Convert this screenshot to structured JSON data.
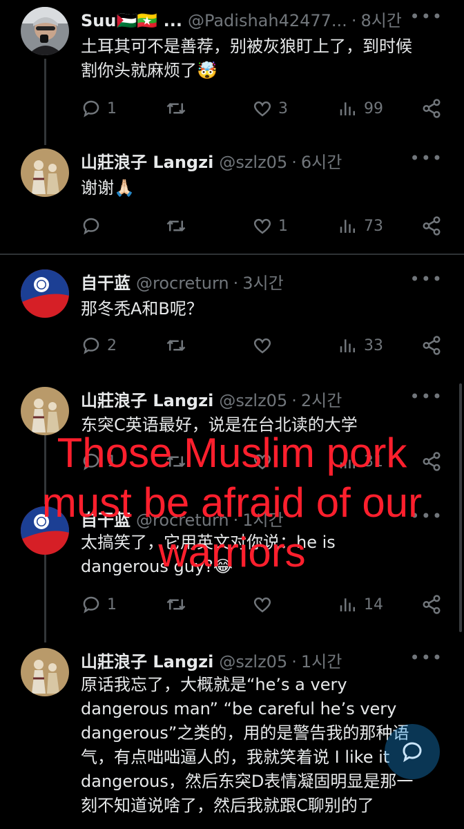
{
  "tweets": [
    {
      "name": "Suu🇵🇸🇲🇲 ...",
      "handle": "@Padishah42477...",
      "sep": "·",
      "time": "8시간",
      "text_lines": [
        "土耳其可不是善荐，别被灰狼盯上了，到时候",
        "割你头就麻烦了🤯"
      ],
      "replies": "1",
      "retweets": "",
      "likes": "3",
      "views": "99",
      "avatar": "man-photo"
    },
    {
      "name": "山莊浪子 Langzi",
      "handle": "@szlz05",
      "sep": "·",
      "time": "6시간",
      "text_lines": [
        "谢谢🙏🏻"
      ],
      "replies": "",
      "retweets": "",
      "likes": "1",
      "views": "73",
      "avatar": "painting"
    },
    {
      "name": "自干蓝",
      "handle": "@rocreturn",
      "sep": "·",
      "time": "3시간",
      "text_lines": [
        "那冬秃A和B呢？"
      ],
      "replies": "2",
      "retweets": "",
      "likes": "",
      "views": "33",
      "avatar": "flag"
    },
    {
      "name": "山莊浪子 Langzi",
      "handle": "@szlz05",
      "sep": "·",
      "time": "2시간",
      "text_lines": [
        "东突C英语最好，说是在台北读的大学"
      ],
      "replies": "1",
      "retweets": "",
      "likes": "",
      "views": "31",
      "avatar": "painting"
    },
    {
      "name": "自干蓝",
      "handle": "@rocreturn",
      "sep": "·",
      "time": "1시간",
      "text_lines": [
        "太搞笑了，它用英文对你说：he is",
        "dangerous guy?😂"
      ],
      "replies": "1",
      "retweets": "",
      "likes": "",
      "views": "14",
      "avatar": "flag"
    },
    {
      "name": "山莊浪子 Langzi",
      "handle": "@szlz05",
      "sep": "·",
      "time": "1시간",
      "text_lines": [
        "原话我忘了，大概就是“he’s a very",
        "dangerous man” “be careful he’s very",
        "dangerous”之类的，用的是警告我的那种语",
        "气，有点咄咄逼人的，我就笑着说 I like it",
        "dangerous，然后东突D表情凝固明显是那一",
        "刻不知道说啥了，然后我就跟C聊别的了"
      ],
      "avatar": "painting"
    }
  ],
  "overlay": {
    "lines": [
      "Those Muslim pork",
      "must be afraid of our",
      "warriors"
    ],
    "color": "#ff1f2d"
  },
  "icons": [
    "reply-icon",
    "retweet-icon",
    "like-icon",
    "views-icon",
    "share-icon",
    "more-icon",
    "compose-icon"
  ],
  "more_label": "•••"
}
